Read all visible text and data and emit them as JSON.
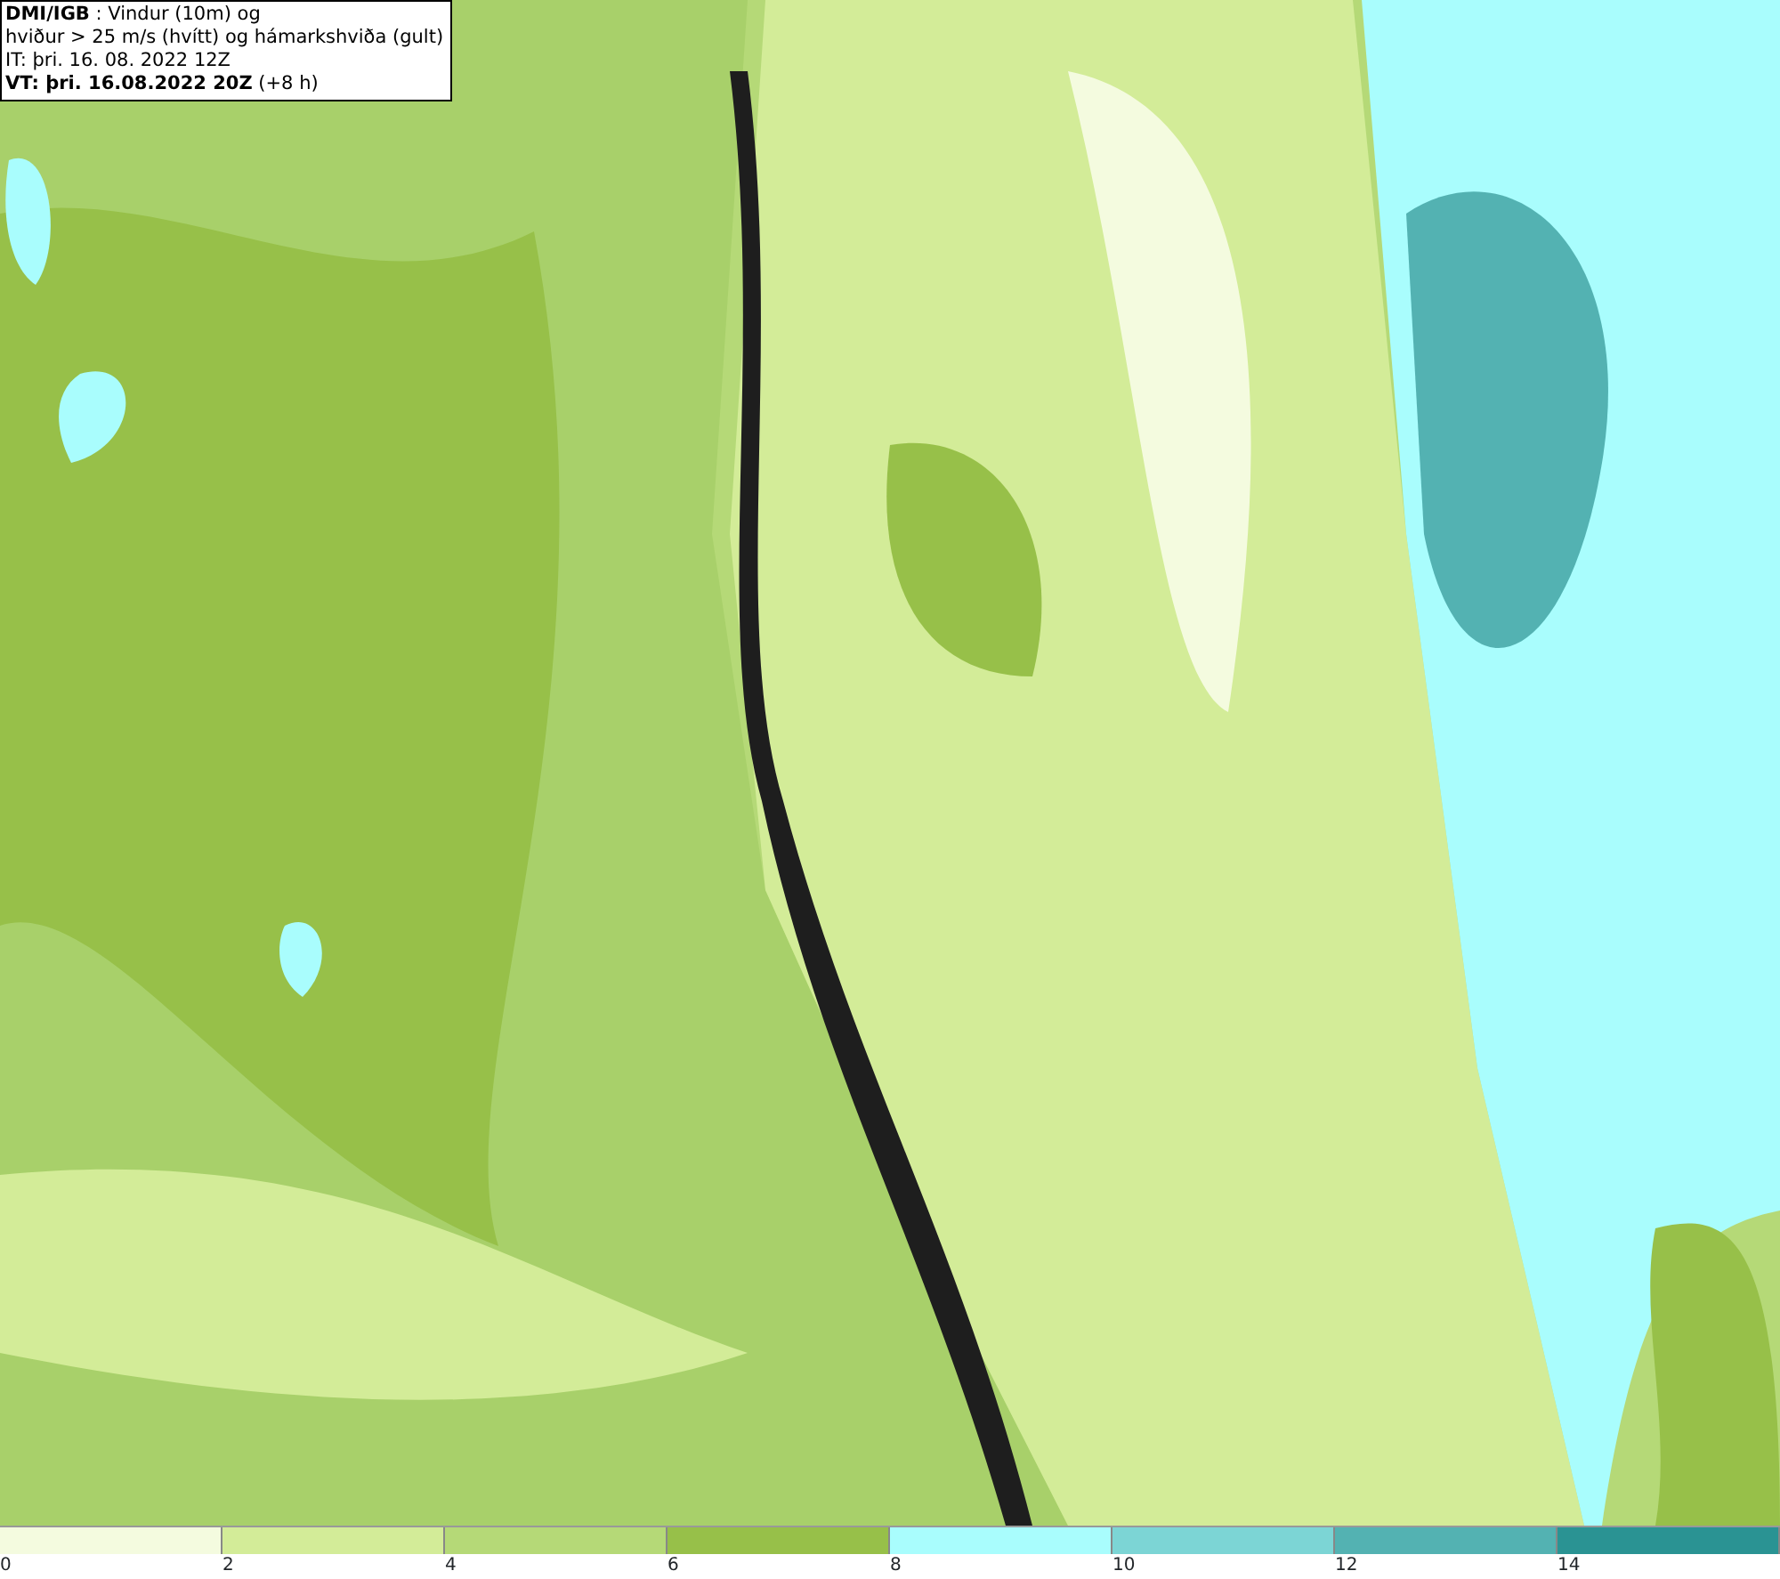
{
  "info_box": {
    "lines": [
      "**DMI/IGB** : Vindur (10m) og",
      "hviður > 25 m/s (hvítt) og hámarkshviða (gult)",
      "IT: þri. 16. 08. 2022 12Z",
      "**VT: þri. 16.08.2022 20Z** (+8 h)"
    ]
  },
  "legend": {
    "bins": [
      {
        "color": "#f4fbdf"
      },
      {
        "color": "#d3ec98"
      },
      {
        "color": "#b5d977"
      },
      {
        "color": "#97c049"
      },
      {
        "color": "#a9fdfd"
      },
      {
        "color": "#7cd5d5"
      },
      {
        "color": "#53b2b2"
      },
      {
        "color": "#2a9393"
      }
    ],
    "ticks": [
      "0",
      "2",
      "4",
      "6",
      "8",
      "10",
      "12",
      "14"
    ]
  }
}
